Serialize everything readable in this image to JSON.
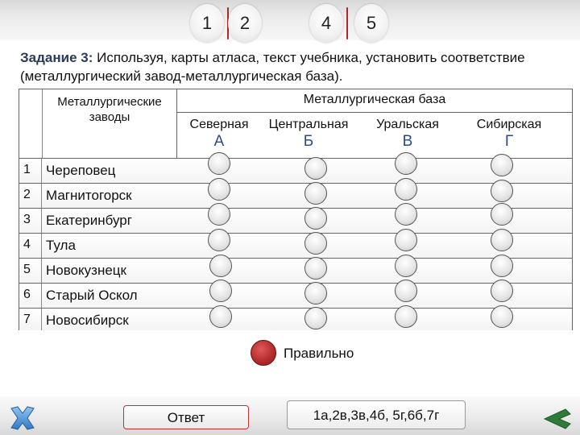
{
  "tabs": [
    {
      "label": "1"
    },
    {
      "label": "2"
    },
    {
      "label": "4"
    },
    {
      "label": "5"
    }
  ],
  "task": {
    "label": "Задание 3:",
    "text": " Используя, карты атласа, текст учебника, установить соответствие (металлургический завод-металлургическая база)."
  },
  "table": {
    "left_header": "Металлургические заводы",
    "base_header": "Металлургическая база",
    "columns": [
      {
        "name": "Северная",
        "letter": "А"
      },
      {
        "name": "Центральная",
        "letter": "Б"
      },
      {
        "name": "Уральская",
        "letter": "В"
      },
      {
        "name": "Сибирская",
        "letter": "Г"
      }
    ],
    "rows": [
      {
        "num": "1",
        "name": "Череповец"
      },
      {
        "num": "2",
        "name": "Магнитогорск"
      },
      {
        "num": "3",
        "name": "Екатеринбург"
      },
      {
        "num": "4",
        "name": "Тула"
      },
      {
        "num": "5",
        "name": "Новокузнецк"
      },
      {
        "num": "6",
        "name": "Старый Оскол"
      },
      {
        "num": "7",
        "name": "Новосибирск"
      }
    ]
  },
  "legend": {
    "label": "Правильно",
    "color": "#b22a2a"
  },
  "answer": {
    "button_label": "Ответ",
    "value": "1а,2в,3в,4б, 5г,6б,7г"
  },
  "icons": {
    "close": "close-x-icon",
    "back": "back-arrow-icon"
  }
}
